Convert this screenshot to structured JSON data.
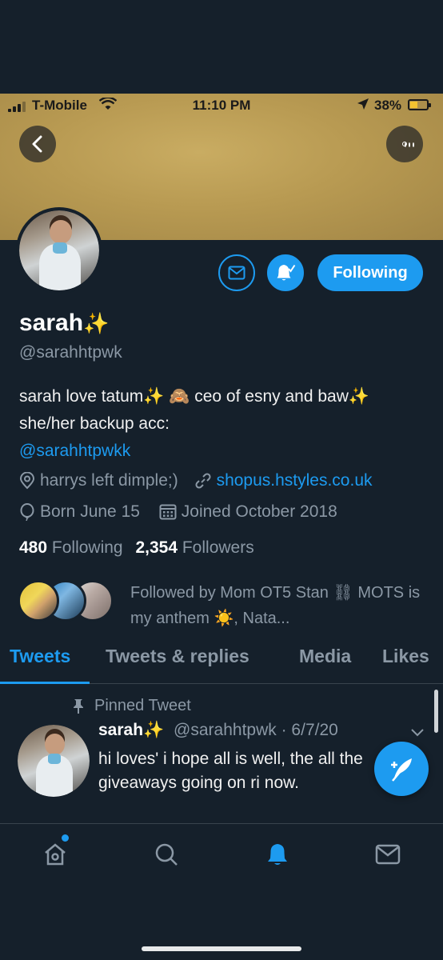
{
  "status_bar": {
    "carrier": "T-Mobile",
    "time": "11:10 PM",
    "battery": "38%"
  },
  "profile": {
    "name": "sarah",
    "name_emoji": "✨",
    "handle": "@sarahhtpwk",
    "bio_part1": "sarah love tatum",
    "bio_part2": "ceo of esny and baw",
    "bio_part3": "she/her backup acc:",
    "bio_link": "@sarahhtpwkk",
    "location": "harrys left dimple;)",
    "website": "shopus.hstyles.co.uk",
    "birthday": "Born June 15",
    "joined": "Joined October 2018",
    "following_count": "480",
    "following_label": "Following",
    "followers_count": "2,354",
    "followers_label": "Followers",
    "followed_by": "Followed by Mom OT5 Stan ⛓ MOTS is my anthem ☀️, Nata..."
  },
  "actions": {
    "following_button": "Following"
  },
  "tabs": [
    {
      "label": "Tweets",
      "active": true
    },
    {
      "label": "Tweets & replies",
      "active": false
    },
    {
      "label": "Media",
      "active": false
    },
    {
      "label": "Likes",
      "active": false
    }
  ],
  "tweet": {
    "pinned_label": "Pinned Tweet",
    "author": "sarah",
    "author_emoji": "✨",
    "handle": "@sarahhtpwk",
    "date": "· 6/7/20",
    "text": "hi loves' i hope all is well, the all the giveaways going on ri now."
  },
  "colors": {
    "accent": "#1d9bf0",
    "background": "#15202b",
    "banner": "#b89a52",
    "muted_text": "#8b98a5"
  },
  "icons": {
    "back": "chevron-left-icon",
    "more": "more-icon",
    "dm": "mail-icon",
    "bell": "bell-icon",
    "location": "location-icon",
    "link": "link-icon",
    "birthday": "balloon-icon",
    "calendar": "calendar-icon",
    "pin": "pin-icon",
    "compose": "compose-icon",
    "nav": [
      "home-icon",
      "search-icon",
      "notifications-icon",
      "messages-icon"
    ]
  }
}
